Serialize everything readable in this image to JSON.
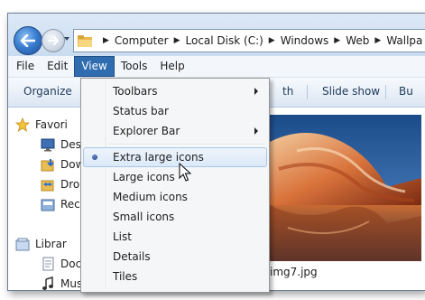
{
  "address_bar": {
    "breadcrumbs": [
      "Computer",
      "Local Disk (C:)",
      "Windows",
      "Web",
      "Wallpa"
    ]
  },
  "menu_bar": {
    "items": [
      {
        "label": "File"
      },
      {
        "label": "Edit"
      },
      {
        "label": "View",
        "active": true
      },
      {
        "label": "Tools"
      },
      {
        "label": "Help"
      }
    ]
  },
  "toolbar": {
    "organize_label": "Organize",
    "share_fragment": "th",
    "slideshow_label": "Slide show",
    "overflow_fragment": "Bu"
  },
  "nav_pane": {
    "items": [
      {
        "label": "Favori",
        "icon": "star-icon"
      },
      {
        "label": "Desk",
        "icon": "desktop-icon"
      },
      {
        "label": "Dow",
        "icon": "downloads-icon"
      },
      {
        "label": "Drop",
        "icon": "dropbox-icon"
      },
      {
        "label": "Rece",
        "icon": "recent-places-icon"
      },
      {
        "label": "Librar",
        "icon": "libraries-icon"
      },
      {
        "label": "Doc",
        "icon": "documents-icon"
      },
      {
        "label": "Mus",
        "icon": "music-icon"
      }
    ]
  },
  "content": {
    "file_label": "img7.jpg"
  },
  "view_menu": {
    "items": [
      {
        "label": "Toolbars",
        "submenu": true
      },
      {
        "label": "Status bar"
      },
      {
        "label": "Explorer Bar",
        "submenu": true
      },
      {
        "label": "Extra large icons",
        "selected": true
      },
      {
        "label": "Large icons"
      },
      {
        "label": "Medium icons"
      },
      {
        "label": "Small icons"
      },
      {
        "label": "List"
      },
      {
        "label": "Details"
      },
      {
        "label": "Tiles"
      }
    ]
  },
  "colors": {
    "menu_active": "#2f6db0",
    "menu_highlight_border": "#a8c7ea",
    "toolbar_text": "#1e395b"
  }
}
